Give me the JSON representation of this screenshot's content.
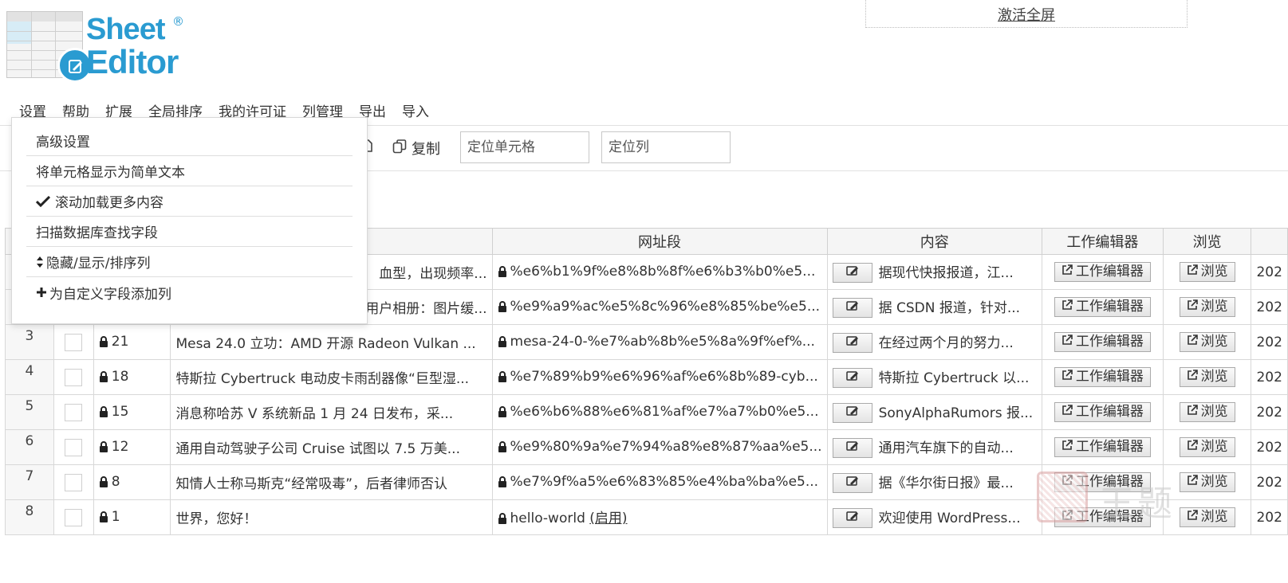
{
  "logo": {
    "line1": "Sheet",
    "line2": "Editor",
    "reg": "®"
  },
  "fullscreen": {
    "label": "激活全屏"
  },
  "menubar": {
    "items": [
      "设置",
      "帮助",
      "扩展",
      "全局排序",
      "我的许可证",
      "列管理",
      "导出",
      "导入"
    ]
  },
  "toolbar": {
    "copy_label": "复制",
    "locate_cell_placeholder": "定位单元格",
    "locate_col_placeholder": "定位列"
  },
  "dropdown": {
    "items": [
      {
        "label": "高级设置",
        "icon": ""
      },
      {
        "label": "将单元格显示为简单文本",
        "icon": ""
      },
      {
        "label": "滚动加载更多内容",
        "icon": "check-icon"
      },
      {
        "label": "扫描数据库查找字段",
        "icon": ""
      },
      {
        "label": "隐藏/显示/排序列",
        "icon": "sort-icon"
      },
      {
        "label": "为自定义字段添加列",
        "icon": "plus-icon"
      }
    ]
  },
  "table": {
    "headers": {
      "slug": "网址段",
      "content": "内容",
      "editor": "工作编辑器",
      "view": "浏览"
    },
    "editor_btn": "工作编辑器",
    "view_btn": "浏览",
    "enable_link": "(启用)",
    "rows": [
      {
        "num": "",
        "id": "",
        "title": "血型，出现频率...",
        "slug": "%e6%b1%9f%e8%8b%8f%e6%b3%b0%e5...",
        "content": "据现代快报报道，江...",
        "date": "202"
      },
      {
        "num": "",
        "id": "",
        "title": "用户相册：图片缓...",
        "slug": "%e9%a9%ac%e5%8c%96%e8%85%be%e5...",
        "content": "据 CSDN 报道，针对...",
        "date": "202"
      },
      {
        "num": "3",
        "id": "21",
        "title": "Mesa 24.0 立功：AMD 开源 Radeon Vulkan ...",
        "slug": "mesa-24-0-%e7%ab%8b%e5%8a%9f%ef%...",
        "content": "在经过两个月的努力...",
        "date": "202"
      },
      {
        "num": "4",
        "id": "18",
        "title": "特斯拉 Cybertruck 电动皮卡雨刮器像“巨型湿...",
        "slug": "%e7%89%b9%e6%96%af%e6%8b%89-cyb...",
        "content": "特斯拉 Cybertruck 以...",
        "date": "202"
      },
      {
        "num": "5",
        "id": "15",
        "title": "消息称哈苏 V 系统新品 1 月 24 日发布，采...",
        "slug": "%e6%b6%88%e6%81%af%e7%a7%b0%e5...",
        "content": "SonyAlphaRumors 报...",
        "date": "202"
      },
      {
        "num": "6",
        "id": "12",
        "title": "通用自动驾驶子公司 Cruise 试图以 7.5 万美...",
        "slug": "%e9%80%9a%e7%94%a8%e8%87%aa%e5...",
        "content": "通用汽车旗下的自动...",
        "date": "202"
      },
      {
        "num": "7",
        "id": "8",
        "title": "知情人士称马斯克“经常吸毒”，后者律师否认",
        "slug": "%e7%9f%a5%e6%83%85%e4%ba%ba%e5...",
        "content": "据《华尔街日报》最...",
        "date": "202"
      },
      {
        "num": "8",
        "id": "1",
        "title": "世界，您好！",
        "slug": "hello-world",
        "content": "欢迎使用 WordPress...",
        "date": "202",
        "has_enable": true
      }
    ]
  },
  "watermark": {
    "text": "王题"
  }
}
